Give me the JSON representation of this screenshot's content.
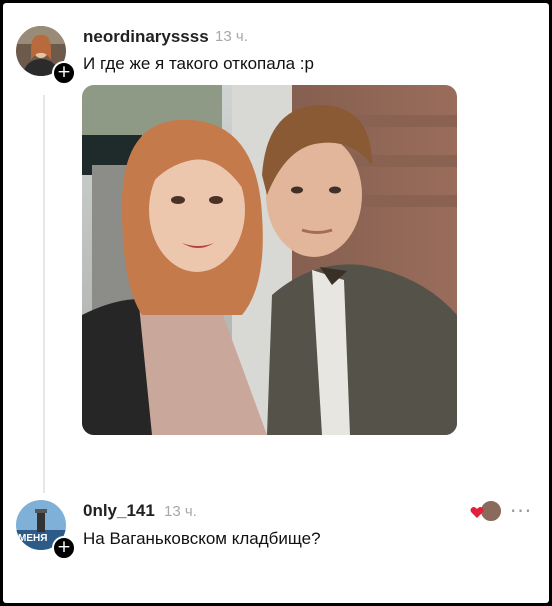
{
  "comments": [
    {
      "username": "neordinaryssss",
      "time": "13 ч.",
      "text": "И где же я такого откопала :р",
      "avatar_icon": "user-avatar-icon",
      "follow_icon": "plus-icon"
    },
    {
      "username": "0nly_141",
      "time": "13 ч.",
      "text": "На Ваганьковском кладбище?",
      "avatar_icon": "user-avatar-icon",
      "avatar_text": "МЕНЯ",
      "follow_icon": "plus-icon",
      "liked_by_icon": "heart-icon",
      "more_icon": "more-icon"
    }
  ],
  "colors": {
    "heart": "#e0203c",
    "muted": "#a8a8a8",
    "thread_line": "#e6e6e6"
  }
}
